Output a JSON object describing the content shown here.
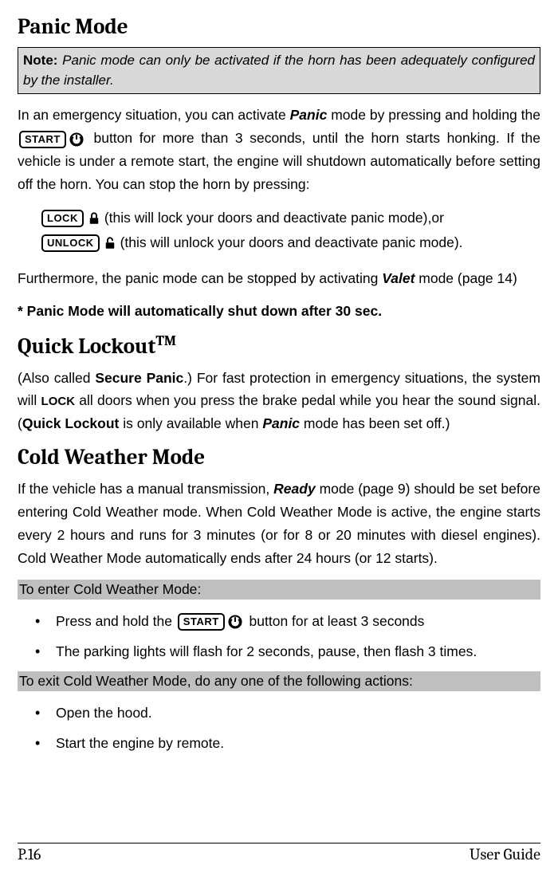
{
  "headings": {
    "panic": "Panic Mode",
    "quick_lockout": "Quick Lockout",
    "quick_lockout_tm": "TM",
    "cold_weather": "Cold Weather Mode"
  },
  "note": {
    "label": "Note:",
    "body": "Panic mode can only be activated if the horn has been adequately configured by the installer."
  },
  "panic": {
    "p1a": "In an emergency situation, you can activate ",
    "p1b": "Panic",
    "p1c": " mode by pressing and holding the ",
    "p1d": " button for more than 3 seconds, until the horn starts honking. If the vehicle is under a remote start, the engine will shutdown automatically before setting off the horn. You can stop the horn by pressing:",
    "lock_suffix": " (this will lock your doors and deactivate panic mode)",
    "lock_comma": ",",
    "lock_or": " or",
    "unlock_suffix": " (this will unlock your doors and deactivate panic mode).",
    "p2a": "Furthermore, the panic mode can be stopped by activating ",
    "p2b": "Valet",
    "p2c": " mode (page 14)",
    "p3": "* Panic Mode will automatically shut down after 30 sec."
  },
  "quick": {
    "p1a": "(Also called ",
    "p1b": "Secure Panic",
    "p1c": ".) For fast protection in emergency situations, the system will ",
    "p1d": "LOCK",
    "p1e": " all doors when you press the brake pedal while you hear the sound signal. (",
    "p1f": "Quick Lockout",
    "p1g": " is only available when ",
    "p1h": "Panic",
    "p1i": " mode has been set off.)"
  },
  "cold": {
    "p1a": "If the vehicle has a manual transmission, ",
    "p1b": "Ready",
    "p1c": " mode (page 9) should be set before entering Cold Weather mode. When Cold Weather Mode is active, the engine starts every 2 hours and runs for 3 minutes (or for 8 or 20 minutes with diesel engines). Cold Weather Mode automatically ends after 24 hours (or 12 starts).",
    "sub1": "To enter Cold Weather Mode:",
    "b1a": "Press and hold the ",
    "b1b": " button for at least 3 seconds",
    "b2": "The parking lights will flash for 2 seconds, pause, then flash 3 times.",
    "sub2": "To exit Cold Weather Mode, do any one of the following actions:",
    "b3": "Open the hood.",
    "b4": "Start the engine by remote."
  },
  "buttons": {
    "start": "START",
    "lock": "LOCK",
    "unlock": "UNLOCK"
  },
  "footer": {
    "left": "P.16",
    "right": "User Guide"
  }
}
